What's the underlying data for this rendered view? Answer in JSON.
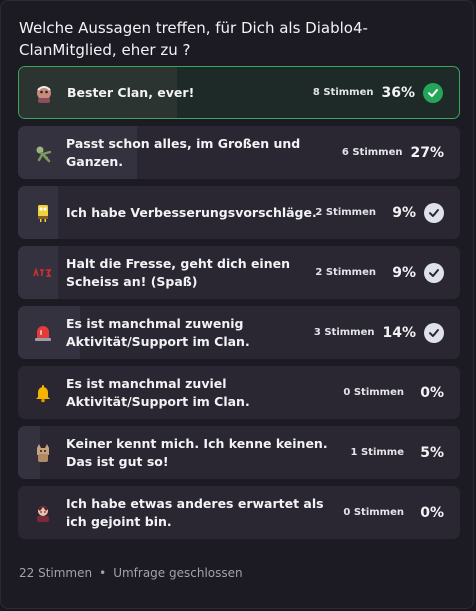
{
  "poll": {
    "question": "Welche Aussagen treffen, für Dich als Diablo4-ClanMitglied, eher zu ?",
    "options": [
      {
        "label": "Bester Clan, ever!",
        "votes": "8 Stimmen",
        "percent": "36%",
        "fill": 0.36,
        "icon": "character-emoji-icon",
        "check": "green-checkmark-icon",
        "winner": true
      },
      {
        "label": "Passt schon alles, im Großen und Ganzen.",
        "votes": "6 Stimmen",
        "percent": "27%",
        "fill": 0.27,
        "icon": "zombie-emoji-icon",
        "check": "",
        "winner": false
      },
      {
        "label": "Ich habe Verbesserungsvorschläge.",
        "votes": "2 Stimmen",
        "percent": "9%",
        "fill": 0.09,
        "icon": "sponge-emoji-icon",
        "check": "checkmark-icon",
        "winner": false
      },
      {
        "label": "Halt die Fresse, geht dich einen Scheiss an! (Spaß)",
        "votes": "2 Stimmen",
        "percent": "9%",
        "fill": 0.09,
        "icon": "stfu-emoji-icon",
        "check": "checkmark-icon",
        "winner": false
      },
      {
        "label": "Es ist manchmal zuwenig Aktivität/Support im Clan.",
        "votes": "3 Stimmen",
        "percent": "14%",
        "fill": 0.14,
        "icon": "siren-emoji-icon",
        "check": "checkmark-icon",
        "winner": false
      },
      {
        "label": "Es ist manchmal zuviel Aktivität/Support im Clan.",
        "votes": "0 Stimmen",
        "percent": "0%",
        "fill": 0.0,
        "icon": "bell-emoji-icon",
        "check": "",
        "winner": false
      },
      {
        "label": "Keiner kennt mich. Ich kenne keinen. Das ist gut so!",
        "votes": "1 Stimme",
        "percent": "5%",
        "fill": 0.05,
        "icon": "cat-emoji-icon",
        "check": "",
        "winner": false
      },
      {
        "label": "Ich habe etwas anderes erwartet als ich gejoint bin.",
        "votes": "0 Stimmen",
        "percent": "0%",
        "fill": 0.0,
        "icon": "anime-emoji-icon",
        "check": "",
        "winner": false
      }
    ],
    "footer": {
      "total": "22 Stimmen",
      "separator": "•",
      "status": "Umfrage geschlossen"
    }
  },
  "colors": {
    "winner_border": "#3aa55d",
    "check_green": "#23a55a",
    "check_white": "#dfe2ea"
  }
}
